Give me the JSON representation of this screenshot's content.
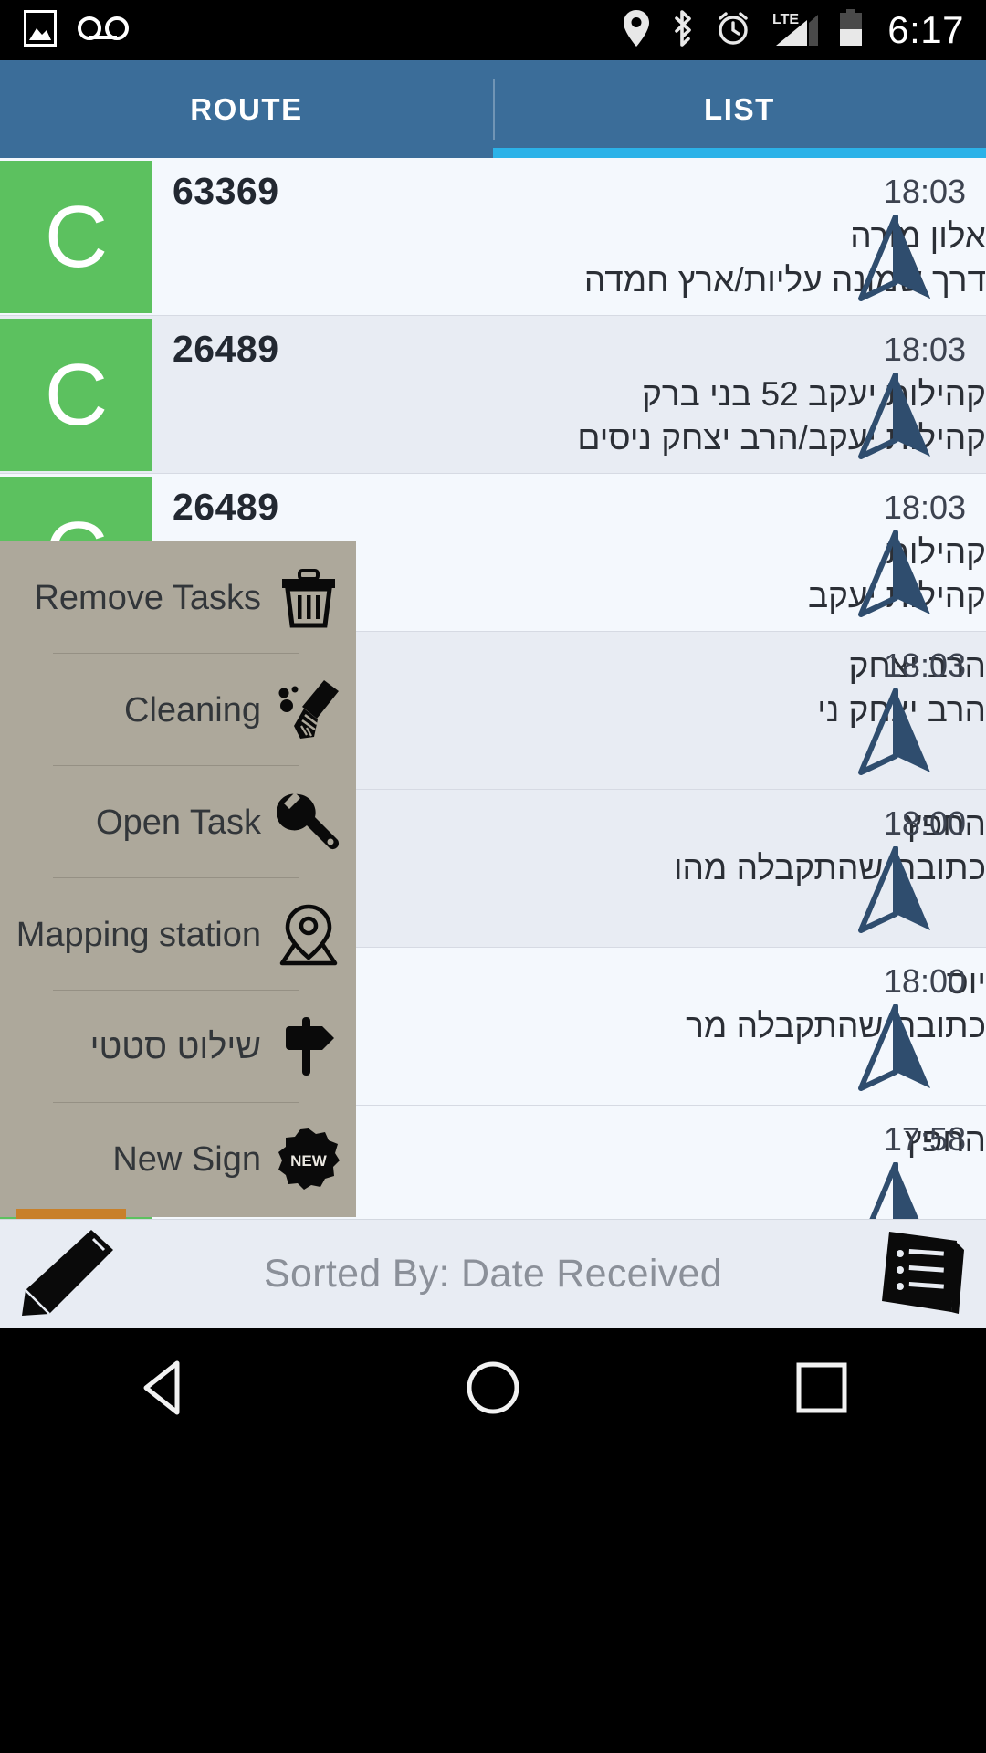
{
  "statusbar": {
    "time": "6:17",
    "left_icons": [
      "gallery-icon",
      "voicemail-icon"
    ],
    "right_icons": [
      "location-icon",
      "bluetooth-icon",
      "alarm-icon",
      "lte-signal-icon",
      "battery-icon"
    ],
    "network_label": "LTE"
  },
  "tabs": {
    "items": [
      {
        "label": "ROUTE",
        "selected": false
      },
      {
        "label": "LIST",
        "selected": true
      }
    ],
    "indicator_color": "#2bb2e8",
    "bar_color": "#3b6d99"
  },
  "list": {
    "avatar_letter": "C",
    "avatar_color": "#5cc15f",
    "rows": [
      {
        "id": "63369",
        "name": "אלון מורה",
        "address": "דרך שמונה עליות/ארץ חמדה",
        "time": "18:03"
      },
      {
        "id": "26489",
        "name": "קהילות יעקב 52 בני ברק",
        "address": "קהילות יעקב/הרב יצחק ניסים",
        "time": "18:03"
      },
      {
        "id": "26489",
        "name": "קהילות",
        "address": "קהילות יעקב",
        "time": "18:03"
      },
      {
        "id": "",
        "name": "הרב יצחק",
        "address": "הרב יצחק ני",
        "time": "18:03"
      },
      {
        "id": "",
        "name": "החפץ",
        "address": "כתובת שהתקבלה מהו",
        "time": "18:00"
      },
      {
        "id": "",
        "name": "יוס",
        "address": "כתובת שהתקבלה מר",
        "time": "18:00"
      },
      {
        "id": "",
        "name": "החפץ",
        "address": "",
        "time": "17:58"
      }
    ]
  },
  "popup_menu": {
    "background": "#ada89b",
    "items": [
      {
        "label": "Remove Tasks",
        "icon": "trash-icon"
      },
      {
        "label": "Cleaning",
        "icon": "broom-icon"
      },
      {
        "label": "Open Task",
        "icon": "wrench-icon"
      },
      {
        "label": "Mapping station",
        "icon": "map-pin-icon"
      },
      {
        "label": "שילוט סטטי",
        "icon": "signpost-icon"
      },
      {
        "label": "New Sign",
        "icon": "new-badge-icon"
      }
    ]
  },
  "bottombar": {
    "sort_text": "Sorted By: Date Received",
    "left_icon": "pencil-icon",
    "right_icon": "document-list-icon"
  },
  "navbar": {
    "buttons": [
      {
        "name": "back",
        "icon": "back-triangle-icon"
      },
      {
        "name": "home",
        "icon": "home-circle-icon"
      },
      {
        "name": "recents",
        "icon": "recents-square-icon"
      }
    ]
  }
}
